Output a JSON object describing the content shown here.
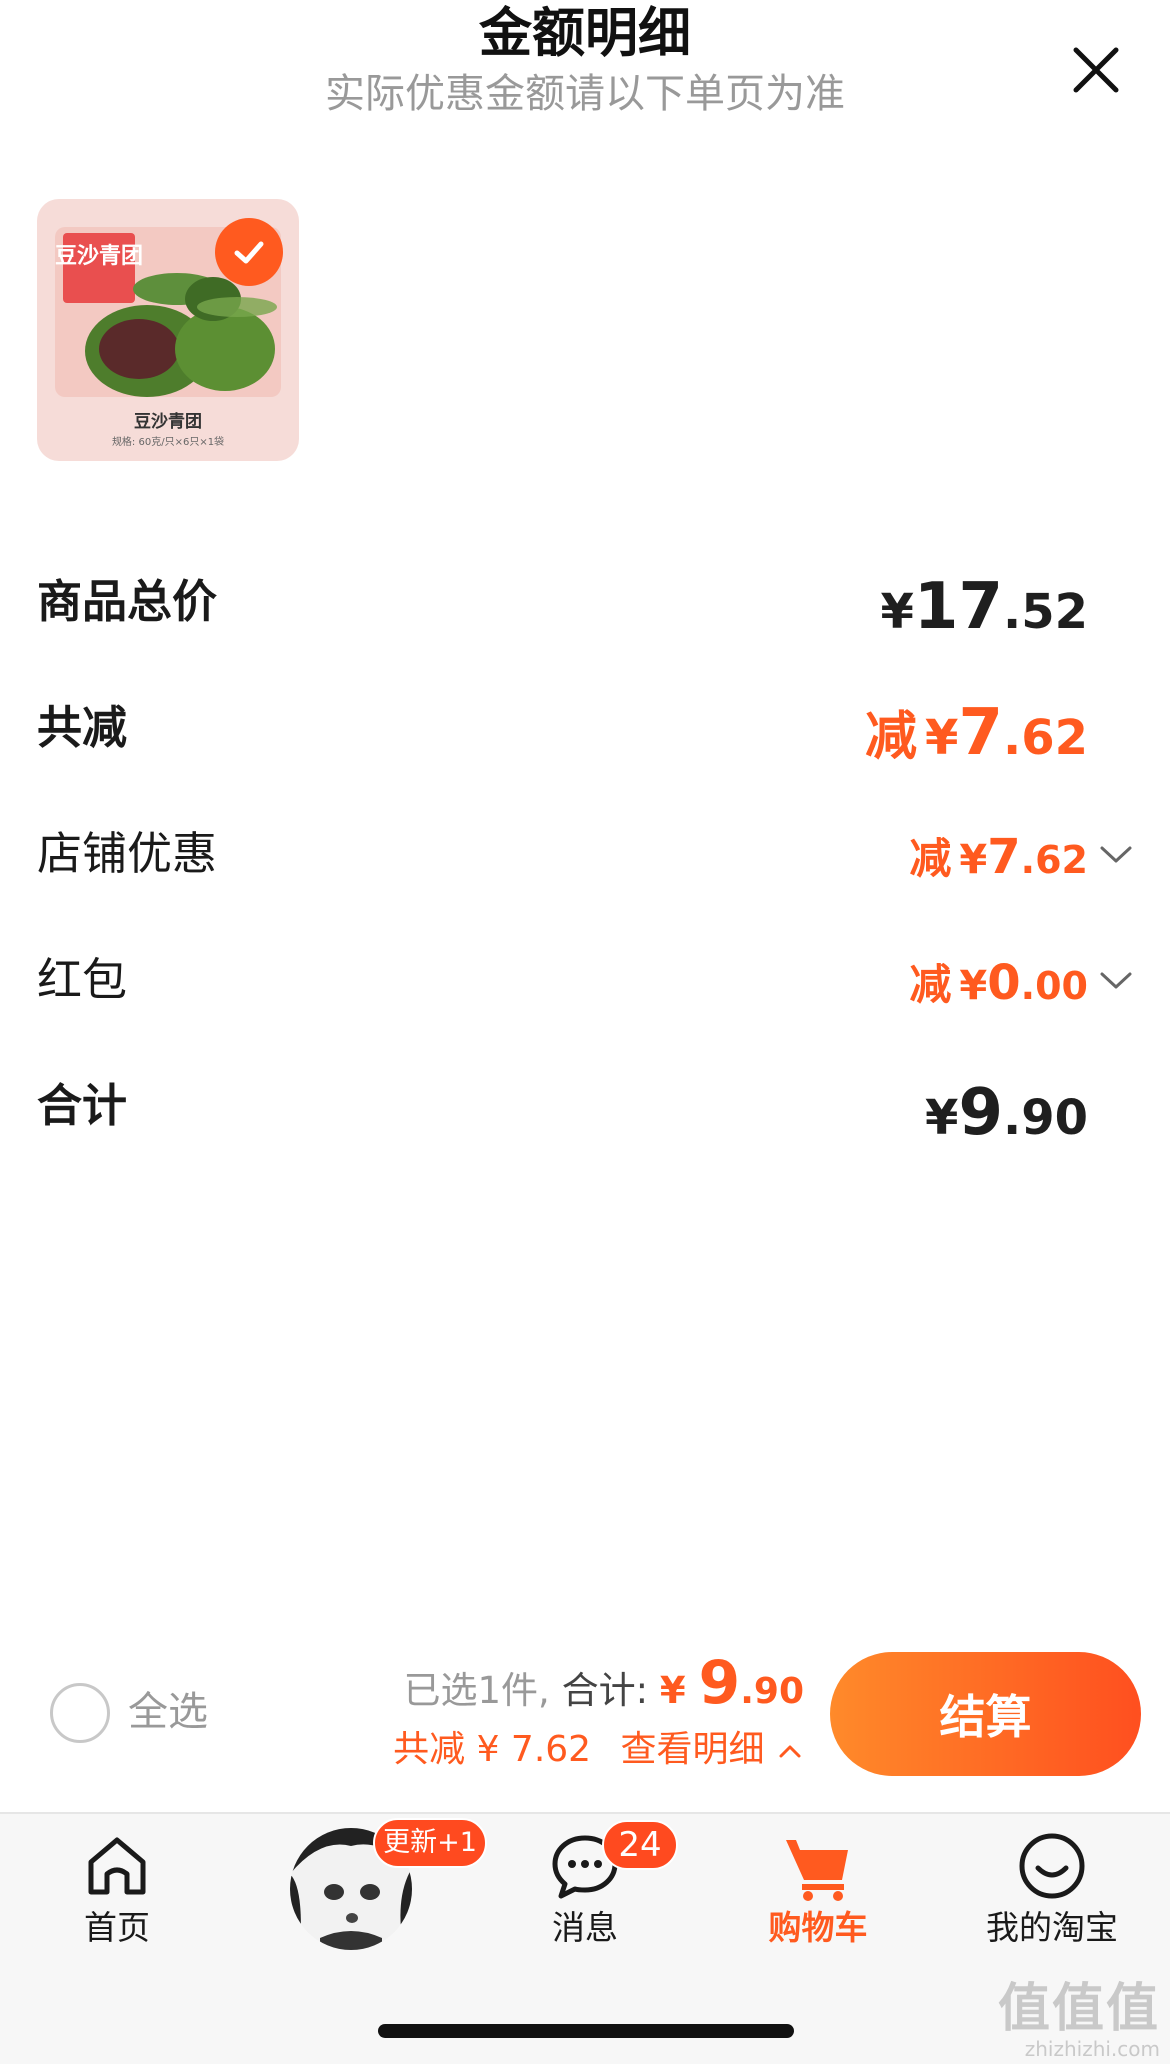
{
  "header": {
    "title": "金额明细",
    "subtitle": "实际优惠金额请以下单页为准"
  },
  "product": {
    "image_text_title": "豆沙青团",
    "image_text_bottom": "豆沙青团",
    "image_text_spec": "规格: 60克/只×6只×1袋",
    "selected": true
  },
  "summary": {
    "total_price": {
      "label": "商品总价",
      "yuan": "¥",
      "int": "17",
      "dec": ".52"
    },
    "total_discount": {
      "label": "共减",
      "prefix": "减",
      "yuan": "¥",
      "int": "7",
      "dec": ".62"
    },
    "shop_discount": {
      "label": "店铺优惠",
      "prefix": "减",
      "yuan": "¥",
      "int": "7",
      "dec": ".62"
    },
    "red_packet": {
      "label": "红包",
      "prefix": "减",
      "yuan": "¥",
      "int": "0",
      "dec": ".00"
    },
    "grand_total": {
      "label": "合计",
      "yuan": "¥",
      "int": "9",
      "dec": ".90"
    }
  },
  "checkout_bar": {
    "select_all_label": "全选",
    "selected_count": "已选1件,",
    "total_label": "合计:",
    "total_yuan": "¥",
    "total_int": "9",
    "total_dec": ".90",
    "discount_text": "共减 ¥ 7.62",
    "detail_link": "查看明细",
    "checkout_label": "结算"
  },
  "tabbar": {
    "tabs": [
      {
        "label": "首页",
        "icon": "home-icon"
      },
      {
        "label": "",
        "icon": "avatar",
        "badge": "更新+1"
      },
      {
        "label": "消息",
        "icon": "message-icon",
        "badge": "24"
      },
      {
        "label": "购物车",
        "icon": "cart-icon",
        "active": true
      },
      {
        "label": "我的淘宝",
        "icon": "smile-icon"
      }
    ]
  },
  "watermark": {
    "logo": "值值值",
    "url": "zhizhizhi.com"
  },
  "colors": {
    "accent": "#ff5a1f",
    "muted": "#999999",
    "text": "#1a1a1a"
  }
}
